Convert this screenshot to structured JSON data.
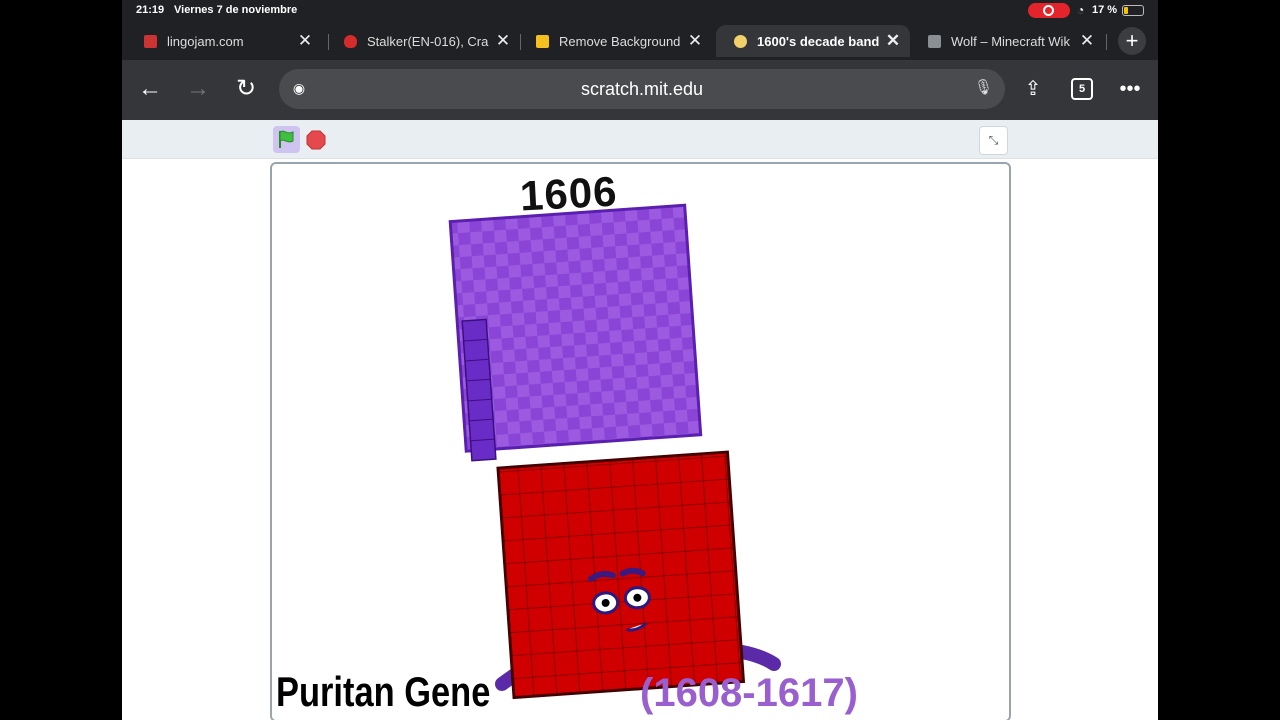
{
  "status": {
    "time": "21:19",
    "date": "Viernes 7 de noviembre",
    "battery": "17 %"
  },
  "tabs": [
    {
      "title": "lingojam.com",
      "favicon_color": "#c33"
    },
    {
      "title": "Stalker(EN-016), Cra",
      "favicon_color": "#d62b2b"
    },
    {
      "title": "Remove Background",
      "favicon_color": "#f4c020"
    },
    {
      "title": "1600's decade band",
      "favicon_color": "#f2d16b",
      "active": true
    },
    {
      "title": "Wolf – Minecraft Wik",
      "favicon_color": "#8a8f94"
    }
  ],
  "toolbar": {
    "url": "scratch.mit.edu",
    "tab_count": "5"
  },
  "stage": {
    "number": "1606",
    "caption": "Puritan Gene",
    "range": "(1608-1617)"
  },
  "colors": {
    "purple": "#8b45d6",
    "red": "#d00000",
    "flag": "#3fbf3f",
    "stop": "#e5484d"
  }
}
